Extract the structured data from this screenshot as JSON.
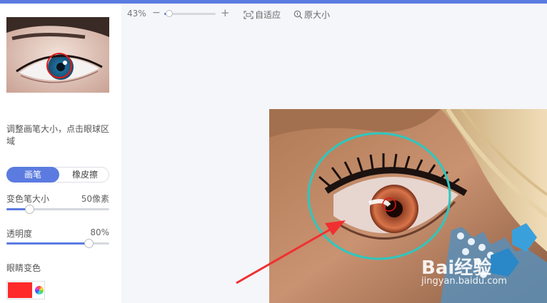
{
  "colors": {
    "accent": "#5b7be0",
    "eye_color": "#ff2a2a",
    "brush_circle": "#2cc8c0",
    "arrow": "#f03030"
  },
  "sidebar": {
    "hint": "调整画笔大小，点击眼球区域",
    "tabs": [
      {
        "label": "画笔",
        "active": true
      },
      {
        "label": "橡皮擦",
        "active": false
      }
    ],
    "brush_size": {
      "label": "变色笔大小",
      "value_text": "50像素",
      "level": 0.22
    },
    "opacity": {
      "label": "透明度",
      "value_text": "80%",
      "level": 0.8
    },
    "eye_color": {
      "label": "眼睛变色"
    }
  },
  "toolbar": {
    "zoom_text": "43%",
    "zoom_level": 0.1,
    "minus": "−",
    "plus": "+",
    "fit_label": "自适应",
    "original_label": "原大小"
  },
  "canvas": {
    "watermark_logo": "Bai经验",
    "watermark_url": "jingyan.baidu.com"
  }
}
